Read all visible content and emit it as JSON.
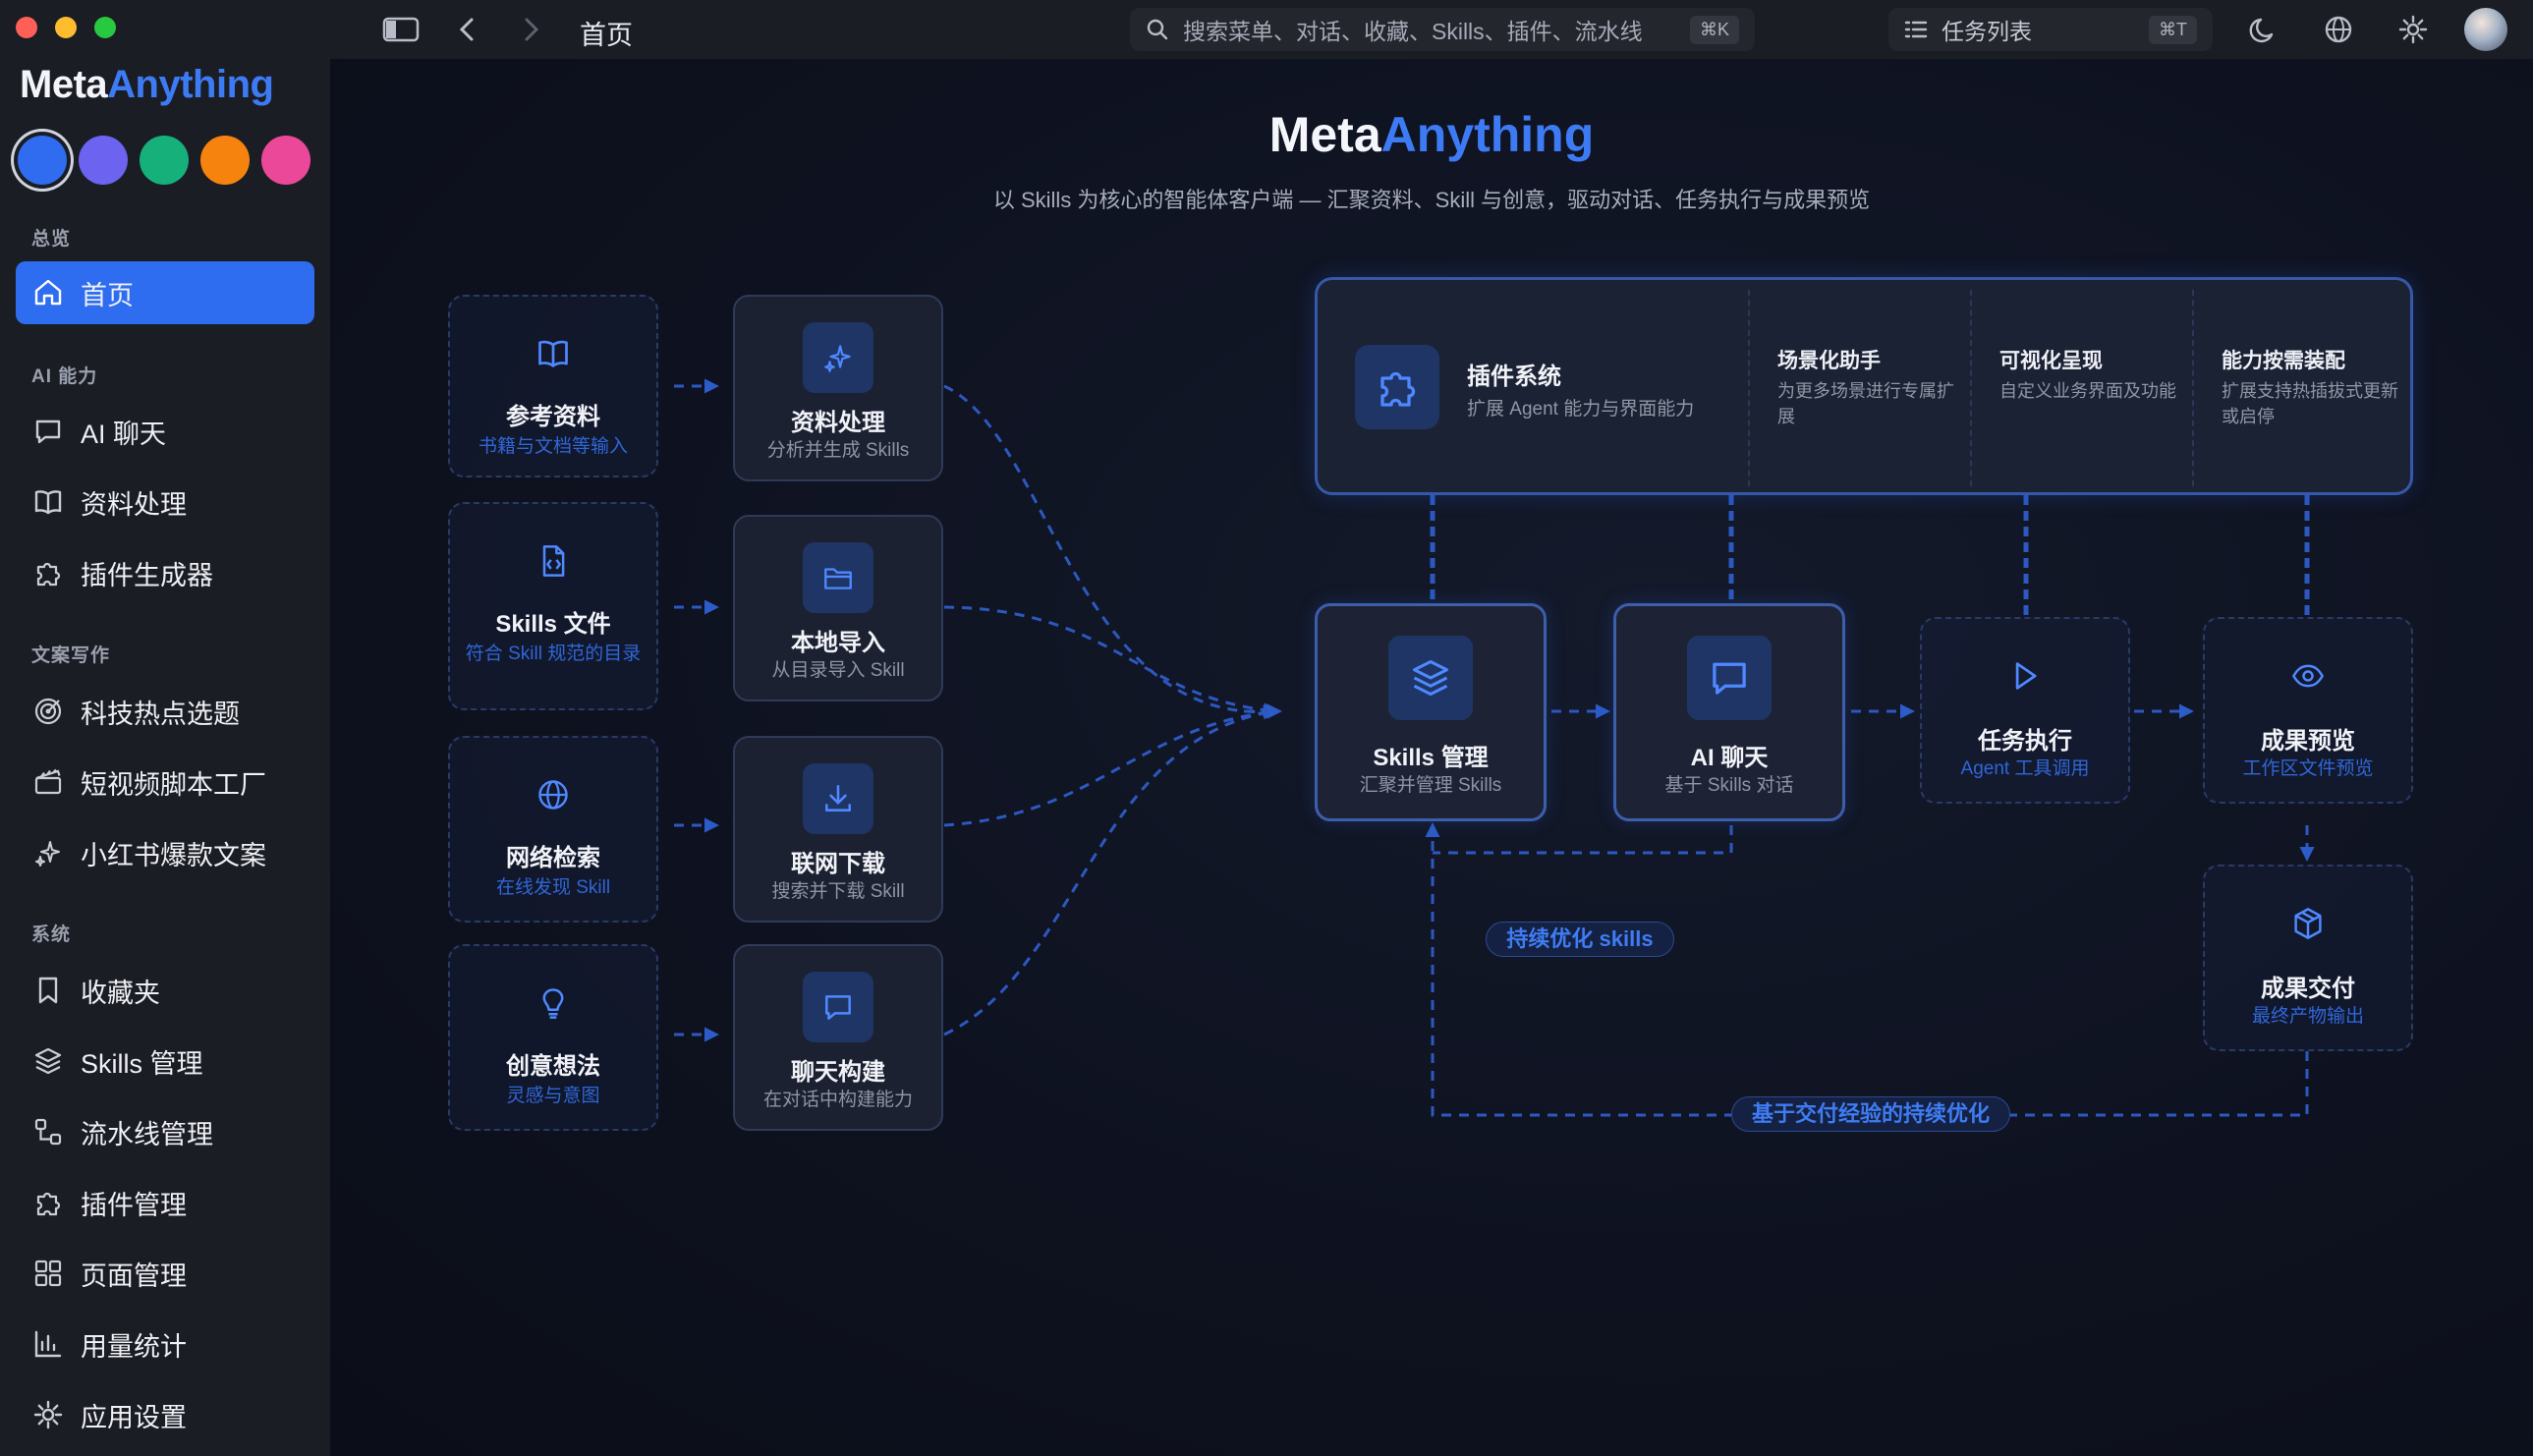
{
  "window": {
    "breadcrumb": "首页"
  },
  "search": {
    "placeholder": "搜索菜单、对话、收藏、Skills、插件、流水线",
    "shortcut": "⌘K"
  },
  "task_list": {
    "label": "任务列表",
    "shortcut": "⌘T"
  },
  "brand": {
    "part1": "Meta",
    "part2": "Anything"
  },
  "theme_colors": [
    "#2f6cf0",
    "#6c63f0",
    "#16b07a",
    "#f7830f",
    "#ec4899"
  ],
  "sidebar": {
    "sections": [
      {
        "title": "总览",
        "items": [
          {
            "label": "首页",
            "icon": "home-icon",
            "active": true
          }
        ]
      },
      {
        "title": "AI 能力",
        "items": [
          {
            "label": "AI 聊天",
            "icon": "chat-icon"
          },
          {
            "label": "资料处理",
            "icon": "book-icon"
          },
          {
            "label": "插件生成器",
            "icon": "puzzle-icon"
          }
        ]
      },
      {
        "title": "文案写作",
        "items": [
          {
            "label": "科技热点选题",
            "icon": "target-icon"
          },
          {
            "label": "短视频脚本工厂",
            "icon": "clapper-icon"
          },
          {
            "label": "小红书爆款文案",
            "icon": "sparkle-icon"
          }
        ]
      },
      {
        "title": "系统",
        "items": [
          {
            "label": "收藏夹",
            "icon": "bookmark-icon"
          },
          {
            "label": "Skills 管理",
            "icon": "layers-icon"
          },
          {
            "label": "流水线管理",
            "icon": "workflow-icon"
          },
          {
            "label": "插件管理",
            "icon": "puzzle-icon"
          },
          {
            "label": "页面管理",
            "icon": "grid-icon"
          },
          {
            "label": "用量统计",
            "icon": "bar-chart-icon"
          },
          {
            "label": "应用设置",
            "icon": "gear-icon"
          }
        ]
      }
    ]
  },
  "hero": {
    "title_part1": "Meta",
    "title_part2": "Anything",
    "subtitle": "以 Skills 为核心的智能体客户端 — 汇聚资料、Skill 与创意，驱动对话、任务执行与成果预览"
  },
  "inputs": [
    {
      "title": "参考资料",
      "sub": "书籍与文档等输入",
      "icon": "book-icon"
    },
    {
      "title": "Skills 文件",
      "sub": "符合 Skill 规范的目录",
      "icon": "file-code-icon"
    },
    {
      "title": "网络检索",
      "sub": "在线发现 Skill",
      "icon": "globe-icon"
    },
    {
      "title": "创意想法",
      "sub": "灵感与意图",
      "icon": "bulb-icon"
    }
  ],
  "processes": [
    {
      "title": "资料处理",
      "sub": "分析并生成 Skills",
      "icon": "sparkle-icon"
    },
    {
      "title": "本地导入",
      "sub": "从目录导入 Skill",
      "icon": "folder-icon"
    },
    {
      "title": "联网下载",
      "sub": "搜索并下载 Skill",
      "icon": "download-icon"
    },
    {
      "title": "聊天构建",
      "sub": "在对话中构建能力",
      "icon": "chat-icon"
    }
  ],
  "plugin_system": {
    "title": "插件系统",
    "desc": "扩展 Agent 能力与界面能力",
    "features": [
      {
        "title": "场景化助手",
        "desc": "为更多场景进行专属扩展"
      },
      {
        "title": "可视化呈现",
        "desc": "自定义业务界面及功能"
      },
      {
        "title": "能力按需装配",
        "desc": "扩展支持热插拔式更新或启停"
      }
    ]
  },
  "core": [
    {
      "title": "Skills 管理",
      "sub": "汇聚并管理 Skills",
      "icon": "layers-icon"
    },
    {
      "title": "AI 聊天",
      "sub": "基于 Skills 对话",
      "icon": "chat-icon"
    }
  ],
  "outputs": [
    {
      "title": "任务执行",
      "sub": "Agent 工具调用",
      "icon": "play-icon"
    },
    {
      "title": "成果预览",
      "sub": "工作区文件预览",
      "icon": "eye-icon"
    },
    {
      "title": "成果交付",
      "sub": "最终产物输出",
      "icon": "package-icon"
    }
  ],
  "loops": {
    "inner": "持续优化 skills",
    "outer": "基于交付经验的持续优化"
  }
}
